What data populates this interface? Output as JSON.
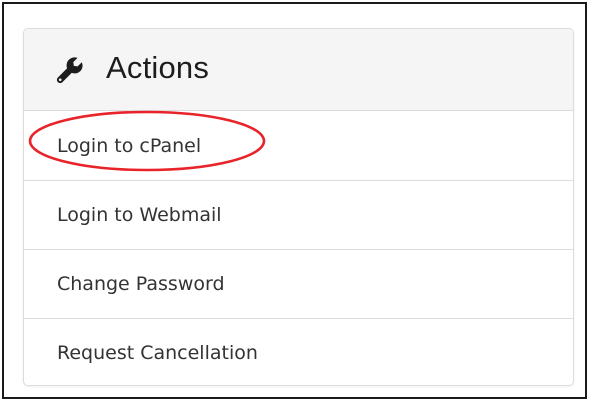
{
  "panel": {
    "title": "Actions",
    "header_icon": "wrench-icon",
    "items": [
      {
        "label": "Login to cPanel",
        "highlighted": true
      },
      {
        "label": "Login to Webmail",
        "highlighted": false
      },
      {
        "label": "Change Password",
        "highlighted": false
      },
      {
        "label": "Request Cancellation",
        "highlighted": false
      }
    ]
  },
  "colors": {
    "highlight": "#e8232a",
    "header_bg": "#f5f5f5",
    "border": "#dcdcdc",
    "text": "#333333"
  }
}
